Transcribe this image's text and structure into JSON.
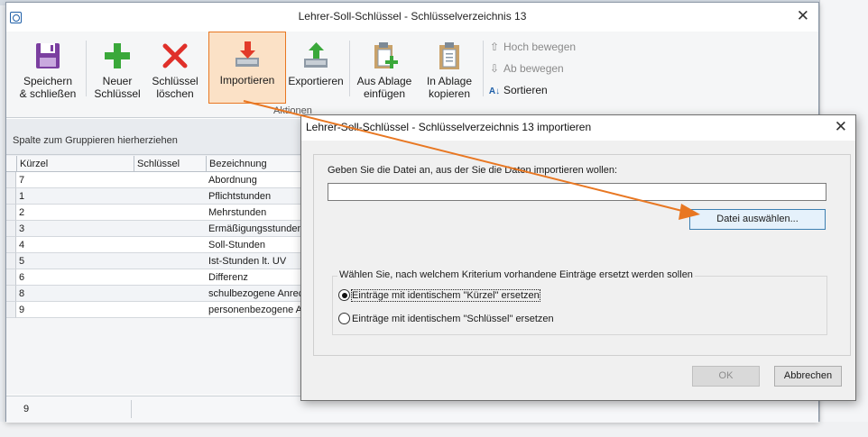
{
  "window": {
    "title": "Lehrer-Soll-Schlüssel - Schlüsselverzeichnis 13"
  },
  "ribbon": {
    "buttons": [
      {
        "line1": "Speichern",
        "line2": "& schließen"
      },
      {
        "line1": "Neuer",
        "line2": "Schlüssel"
      },
      {
        "line1": "Schlüssel",
        "line2": "löschen"
      },
      {
        "line1": "Importieren",
        "line2": ""
      },
      {
        "line1": "Exportieren",
        "line2": ""
      },
      {
        "line1": "Aus Ablage",
        "line2": "einfügen"
      },
      {
        "line1": "In Ablage",
        "line2": "kopieren"
      }
    ],
    "small": {
      "up": "Hoch bewegen",
      "down": "Ab bewegen",
      "sort": "Sortieren"
    },
    "group_label": "Aktionen"
  },
  "grid": {
    "group_hint": "Spalte zum Gruppieren hierherziehen",
    "columns": [
      "Kürzel",
      "Schlüssel",
      "Bezeichnung"
    ],
    "rows": [
      {
        "kuerzel": "7",
        "schluessel": "",
        "bezeichnung": "Abordnung"
      },
      {
        "kuerzel": "1",
        "schluessel": "",
        "bezeichnung": "Pflichtstunden"
      },
      {
        "kuerzel": "2",
        "schluessel": "",
        "bezeichnung": "Mehrstunden"
      },
      {
        "kuerzel": "3",
        "schluessel": "",
        "bezeichnung": "Ermäßigungsstunden"
      },
      {
        "kuerzel": "4",
        "schluessel": "",
        "bezeichnung": "Soll-Stunden"
      },
      {
        "kuerzel": "5",
        "schluessel": "",
        "bezeichnung": "Ist-Stunden lt. UV"
      },
      {
        "kuerzel": "6",
        "schluessel": "",
        "bezeichnung": "Differenz"
      },
      {
        "kuerzel": "8",
        "schluessel": "",
        "bezeichnung": "schulbezogene Anrechnung"
      },
      {
        "kuerzel": "9",
        "schluessel": "",
        "bezeichnung": "personenbezogene Anrechnung"
      }
    ],
    "footer_count": "9"
  },
  "dialog": {
    "title": "Lehrer-Soll-Schlüssel - Schlüsselverzeichnis 13 importieren",
    "prompt": "Geben Sie die Datei an, aus der Sie die Daten importieren wollen:",
    "file_value": "",
    "choose_label": "Datei auswählen...",
    "criteria_legend": "Wählen Sie, nach welchem Kriterium vorhandene Einträge ersetzt werden  sollen",
    "option_kuerzel": "Einträge mit identischem \"Kürzel\" ersetzen",
    "option_schluessel": "Einträge mit identischem \"Schlüssel\" ersetzen",
    "ok_label": "OK",
    "cancel_label": "Abbrechen"
  },
  "colors": {
    "accent": "#e87722",
    "dialog_button_border": "#3c7fb1"
  }
}
